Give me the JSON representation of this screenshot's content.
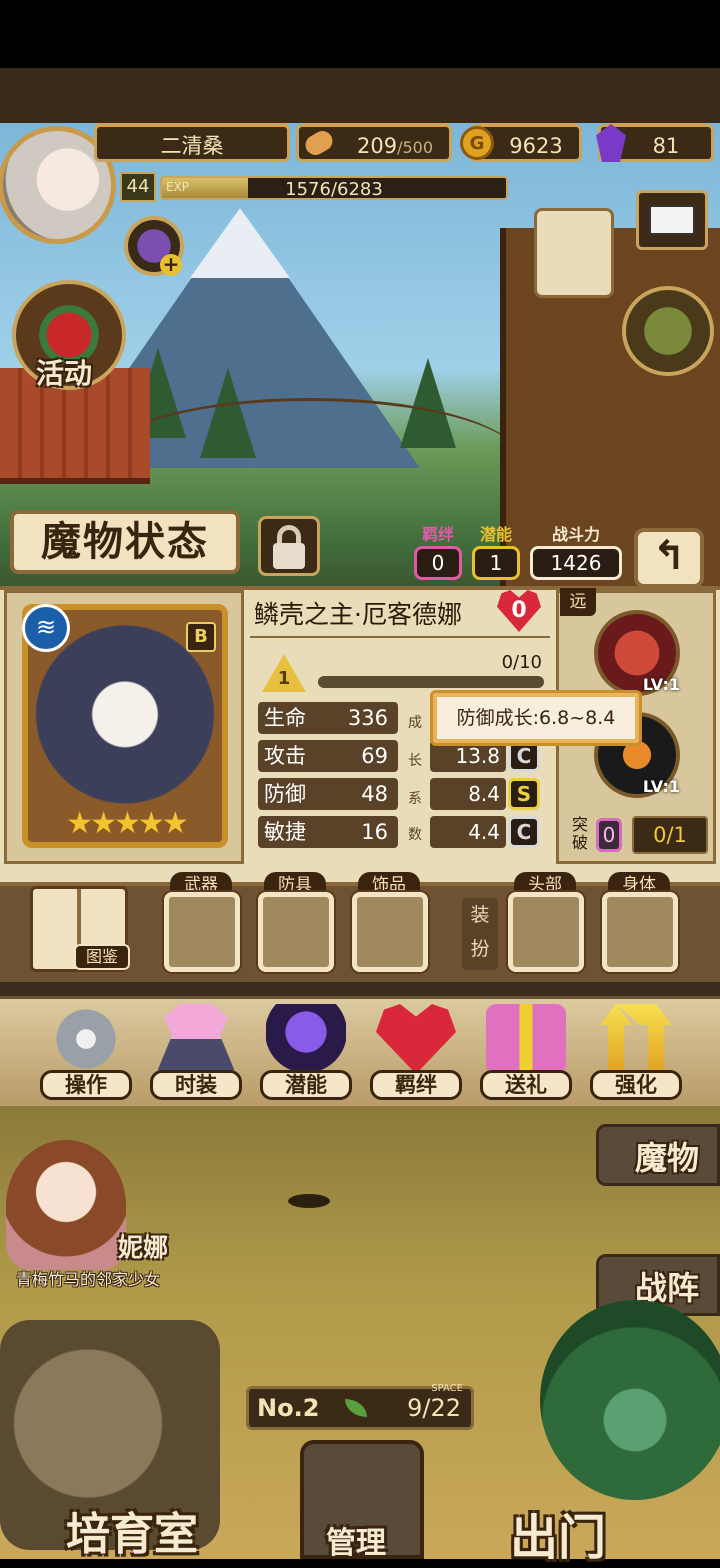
{
  "player": {
    "name": "二清桑",
    "level": "44",
    "exp_label": "EXP",
    "exp_text": "1576/6283",
    "exp_ratio": 0.25
  },
  "resources": {
    "stamina_current": "209",
    "stamina_max": "/500",
    "gold": "9623",
    "gold_icon_glyph": "G",
    "gems": "81"
  },
  "side": {
    "event_label": "活动"
  },
  "status": {
    "title": "魔物状态",
    "bond_label": "羁绊",
    "bond_value": "0",
    "potential_label": "潜能",
    "potential_value": "1",
    "power_label": "战斗力",
    "power_value": "1426",
    "back_glyph": "↰"
  },
  "monster": {
    "name": "鳞壳之主·厄客德娜",
    "heart_value": "0",
    "rank": "B",
    "element_glyph": "≋",
    "stars": "★★★★★",
    "level_badge": "1",
    "level_progress": "0/10",
    "stats": [
      {
        "label": "生命",
        "value": "336",
        "growth": "",
        "grade": ""
      },
      {
        "label": "攻击",
        "value": "69",
        "growth": "13.8",
        "grade": "C"
      },
      {
        "label": "防御",
        "value": "48",
        "growth": "8.4",
        "grade": "S"
      },
      {
        "label": "敏捷",
        "value": "16",
        "growth": "4.4",
        "grade": "C"
      }
    ],
    "growth_vertical": [
      "成",
      "长",
      "系",
      "数"
    ],
    "tooltip": "防御成长:6.8~8.4"
  },
  "skills": {
    "range_tag": "远",
    "skill1_level": "LV:1",
    "skill2_level": "LV:1",
    "break_label": "突破",
    "break_value": "0",
    "break_count": "0/1"
  },
  "equipment": {
    "book_label": "图鉴",
    "slots": [
      "武器",
      "防具",
      "饰品",
      "头部",
      "身体"
    ],
    "dress_label": "装扮"
  },
  "actions": [
    {
      "label": "操作"
    },
    {
      "label": "时装"
    },
    {
      "label": "潜能"
    },
    {
      "label": "羁绊"
    },
    {
      "label": "送礼"
    },
    {
      "label": "强化"
    }
  ],
  "scene": {
    "npc_name": "妮娜",
    "npc_subtitle": "青梅竹马的邻家少女",
    "monster_btn": "魔物",
    "formation_btn": "战阵",
    "space_no": "No.2",
    "space_label": "SPACE",
    "space_count": "9/22",
    "nursery": "培育室",
    "manage": "管理",
    "go_out": "出门"
  },
  "colors": {
    "bond": "#e05aa8",
    "potential": "#e8c030",
    "grade_s": "#e8d040",
    "grade_c": "#d8d8d8"
  }
}
